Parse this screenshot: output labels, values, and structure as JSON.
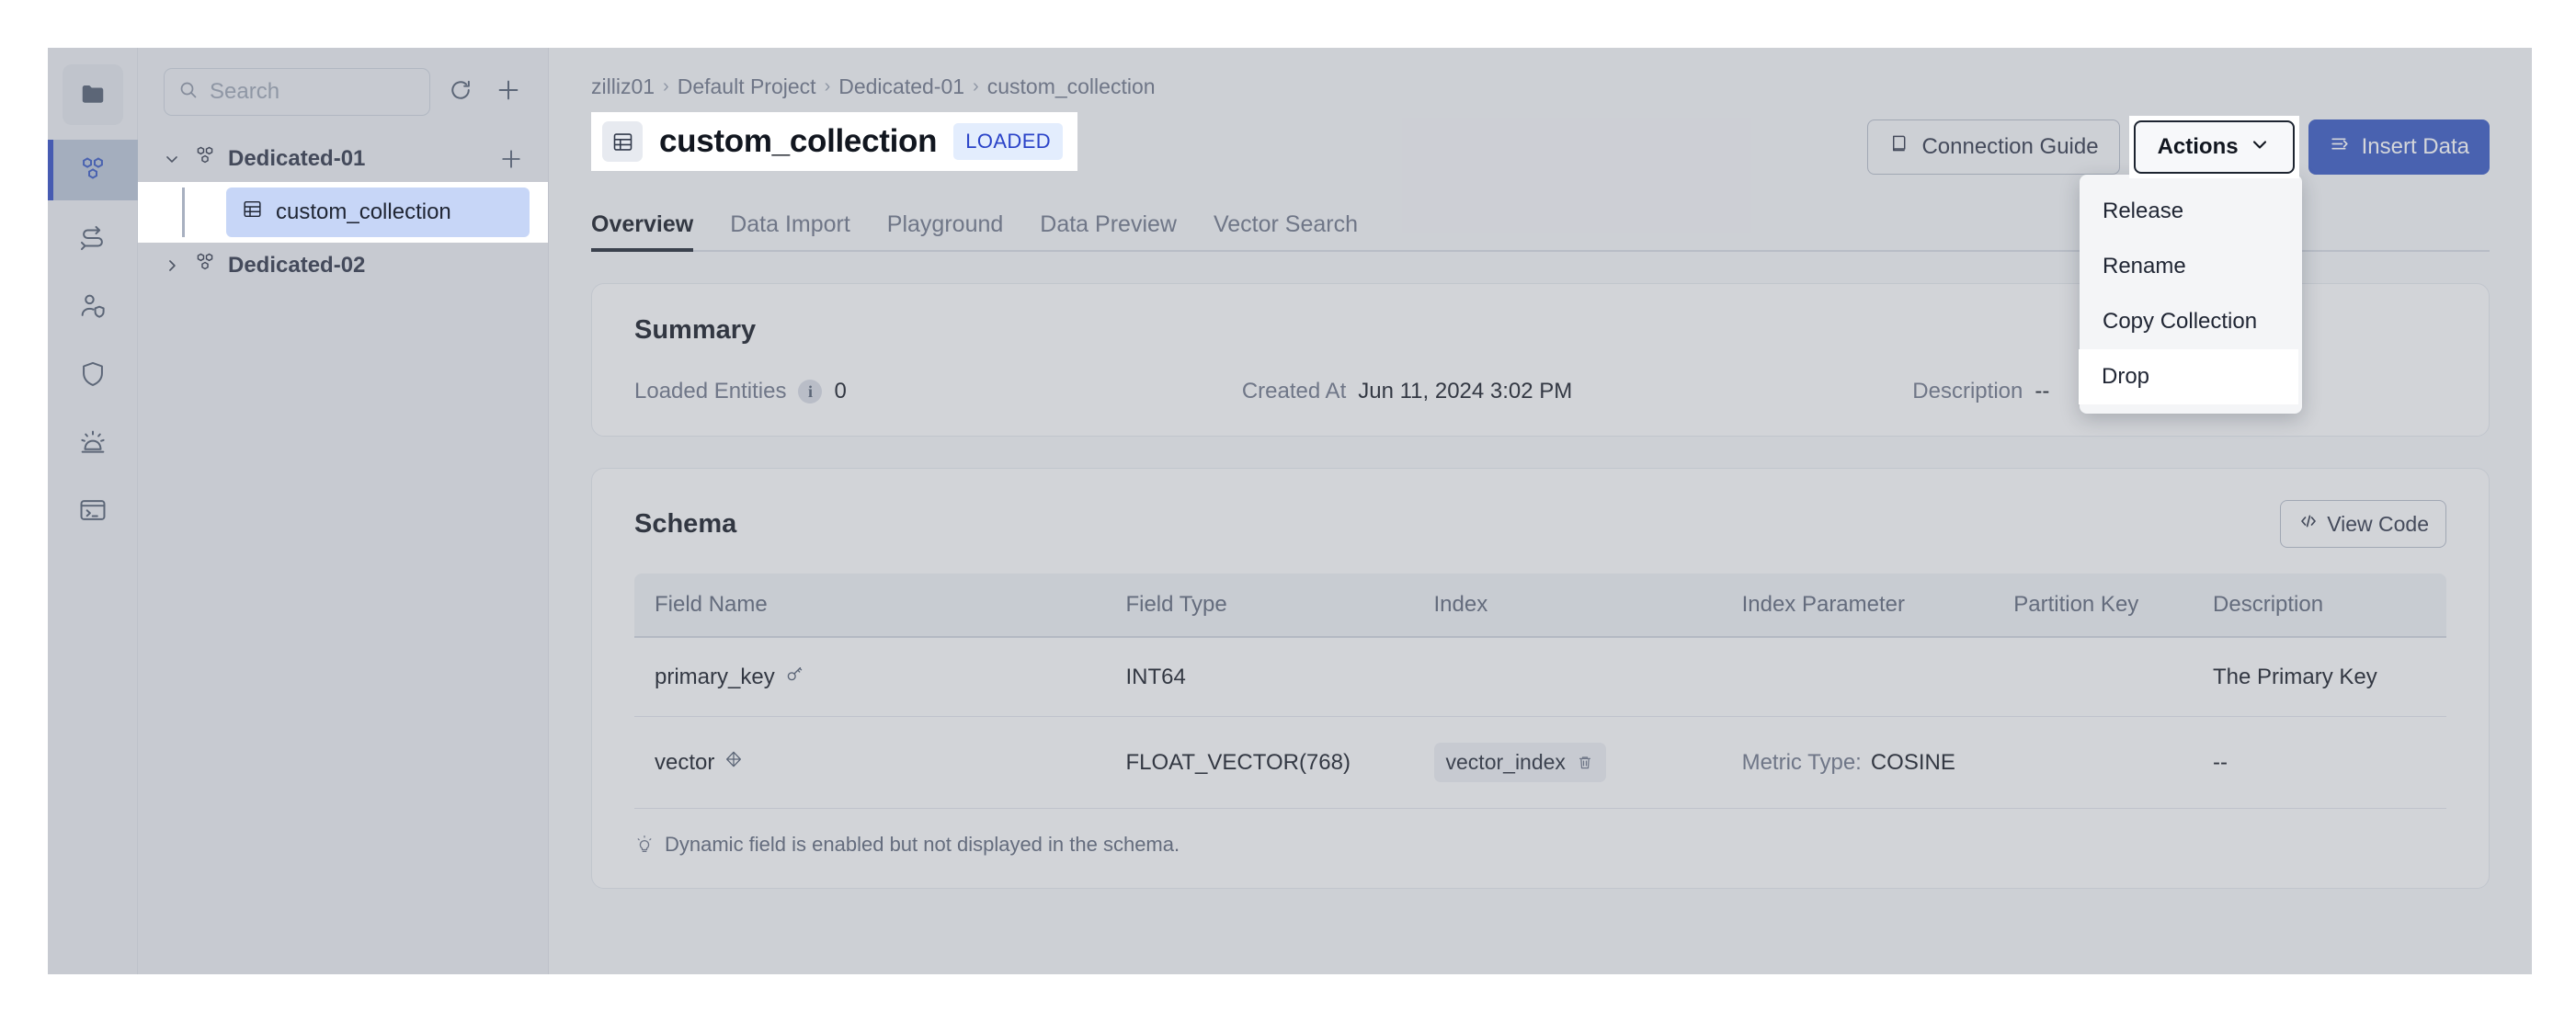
{
  "rail": {
    "items": [
      {
        "name": "folder-icon",
        "label": "Projects"
      },
      {
        "name": "collections-icon",
        "label": "Collections"
      },
      {
        "name": "migration-icon",
        "label": "Migration"
      },
      {
        "name": "user-access-icon",
        "label": "Users"
      },
      {
        "name": "shield-icon",
        "label": "Security"
      },
      {
        "name": "alert-icon",
        "label": "Alerts"
      },
      {
        "name": "terminal-icon",
        "label": "CLI"
      }
    ]
  },
  "sidebar": {
    "search_placeholder": "Search",
    "search_value": "",
    "refresh_icon": "refresh-icon",
    "add_icon": "plus-icon",
    "groups": [
      {
        "label": "Dedicated-01",
        "expanded": true,
        "add_icon": "plus-icon"
      },
      {
        "label": "Dedicated-02",
        "expanded": false
      }
    ],
    "selected_collection": "custom_collection"
  },
  "breadcrumb": {
    "items": [
      "zilliz01",
      "Default Project",
      "Dedicated-01",
      "custom_collection"
    ],
    "separator": "›"
  },
  "header": {
    "collection_icon": "table-icon",
    "title": "custom_collection",
    "status_badge": "LOADED",
    "connection_guide_label": "Connection Guide",
    "connection_guide_icon": "book-icon",
    "actions_label": "Actions",
    "actions_caret": "chevron-down-icon",
    "insert_data_label": "Insert Data",
    "insert_data_icon": "import-icon"
  },
  "actions_menu": {
    "items": [
      {
        "label": "Release",
        "highlighted": false
      },
      {
        "label": "Rename",
        "highlighted": false
      },
      {
        "label": "Copy Collection",
        "highlighted": false
      },
      {
        "label": "Drop",
        "highlighted": true
      }
    ]
  },
  "tabs": [
    {
      "label": "Overview",
      "active": true
    },
    {
      "label": "Data Import",
      "active": false
    },
    {
      "label": "Playground",
      "active": false
    },
    {
      "label": "Data Preview",
      "active": false
    },
    {
      "label": "Vector Search",
      "active": false
    }
  ],
  "summary": {
    "title": "Summary",
    "loaded_entities_label": "Loaded Entities",
    "loaded_entities_info": "i",
    "loaded_entities_value": "0",
    "created_at_label": "Created At",
    "created_at_value": "Jun 11, 2024 3:02 PM",
    "description_label": "Description",
    "description_value": "--"
  },
  "schema": {
    "title": "Schema",
    "view_code_label": "View Code",
    "view_code_icon": "code-icon",
    "columns": [
      "Field Name",
      "Field Type",
      "Index",
      "Index Parameter",
      "Partition Key",
      "Description"
    ],
    "rows": [
      {
        "field_name": "primary_key",
        "field_icon": "key-icon",
        "field_type": "INT64",
        "index": "",
        "index_parameter": "",
        "partition_key": "",
        "description": "The Primary Key"
      },
      {
        "field_name": "vector",
        "field_icon": "vector-icon",
        "field_type": "FLOAT_VECTOR(768)",
        "index": "vector_index",
        "index_delete_icon": "trash-icon",
        "index_parameter_label": "Metric Type:",
        "index_parameter_value": "COSINE",
        "partition_key": "",
        "description": "--"
      }
    ],
    "note": "Dynamic field is enabled but not displayed in the schema.",
    "note_icon": "bulb-icon"
  },
  "colors": {
    "accent": "#3355c2",
    "badge_bg": "#e3edfd",
    "badge_text": "#2a43c8",
    "selected_row": "#c7d6f7",
    "veil": "rgba(120,126,140,0.32)"
  }
}
